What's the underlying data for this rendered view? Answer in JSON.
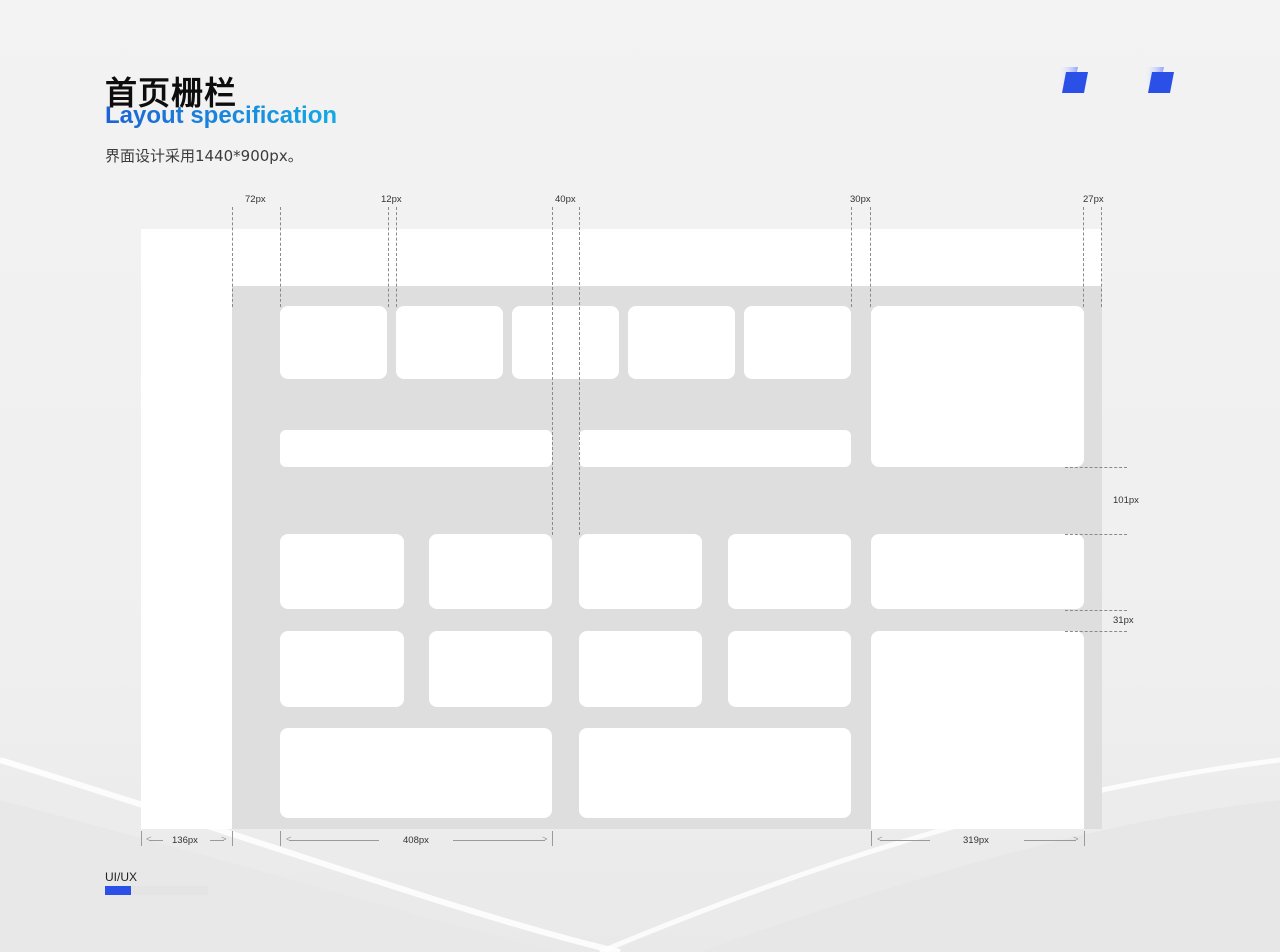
{
  "header": {
    "title": "首页栅栏",
    "subtitle": "Layout specification",
    "description": "界面设计采用1440*900px。"
  },
  "annotations": {
    "top": [
      "72px",
      "12px",
      "40px",
      "30px",
      "27px"
    ],
    "right": [
      "101px",
      "31px"
    ],
    "bottom": [
      "136px",
      "408px",
      "319px"
    ]
  },
  "footer": {
    "label": "UI/UX",
    "progress": 0.25
  },
  "colors": {
    "accent": "#2b50e8",
    "grid_gray": "#dedede",
    "card": "#ffffff"
  },
  "icons": [
    "parallelogram-logo-icon",
    "parallelogram-logo-icon"
  ]
}
